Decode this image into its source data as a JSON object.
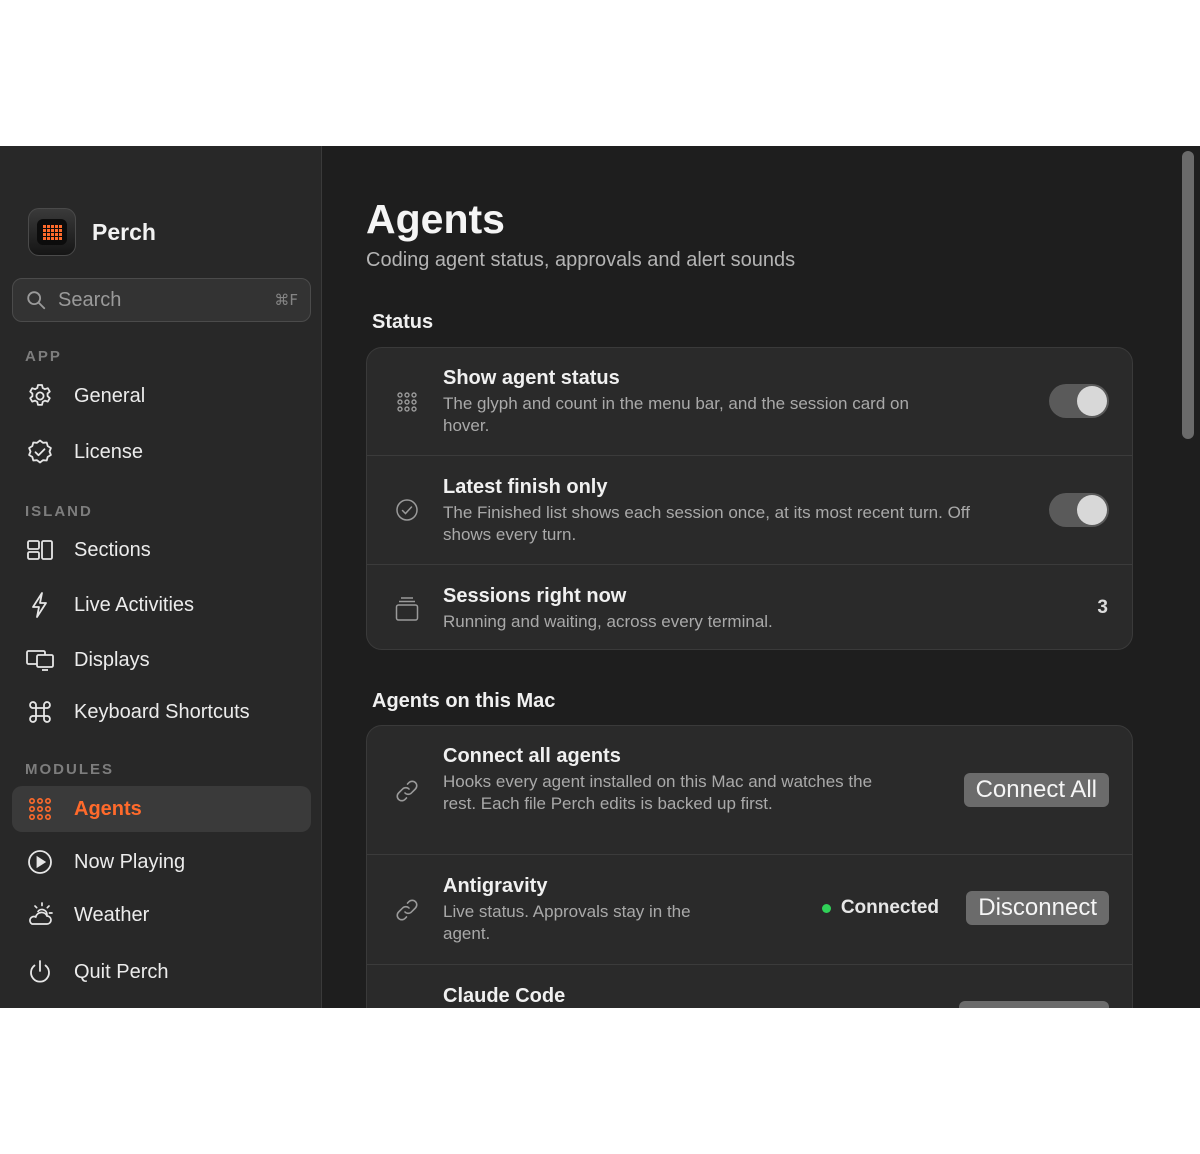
{
  "app": {
    "name": "Perch"
  },
  "search": {
    "placeholder": "Search",
    "shortcut": "⌘F"
  },
  "sidebar": {
    "sections": [
      {
        "label": "APP",
        "items": [
          {
            "label": "General",
            "icon": "gear-icon"
          },
          {
            "label": "License",
            "icon": "verified-badge-icon"
          }
        ]
      },
      {
        "label": "ISLAND",
        "items": [
          {
            "label": "Sections",
            "icon": "sections-layout-icon"
          },
          {
            "label": "Live Activities",
            "icon": "bolt-icon"
          },
          {
            "label": "Displays",
            "icon": "displays-icon"
          },
          {
            "label": "Keyboard Shortcuts",
            "icon": "command-icon"
          }
        ]
      },
      {
        "label": "MODULES",
        "items": [
          {
            "label": "Agents",
            "icon": "dot-grid-icon",
            "active": true
          },
          {
            "label": "Now Playing",
            "icon": "play-circle-icon"
          },
          {
            "label": "Weather",
            "icon": "weather-icon"
          }
        ]
      }
    ],
    "quit_label": "Quit Perch"
  },
  "page": {
    "title": "Agents",
    "subtitle": "Coding agent status, approvals and alert sounds"
  },
  "status_group": {
    "title": "Status",
    "rows": [
      {
        "title": "Show agent status",
        "desc": "The glyph and count in the menu bar, and the session card on hover.",
        "toggle": true
      },
      {
        "title": "Latest finish only",
        "desc": "The Finished list shows each session once, at its most recent turn. Off shows every turn.",
        "toggle": true
      },
      {
        "title": "Sessions right now",
        "desc": "Running and waiting, across every terminal.",
        "value": "3"
      }
    ]
  },
  "agents_group": {
    "title": "Agents on this Mac",
    "connect_all": {
      "title": "Connect all agents",
      "desc": "Hooks every agent installed on this Mac and watches the rest. Each file Perch edits is backed up first.",
      "button": "Connect All"
    },
    "agents": [
      {
        "title": "Antigravity",
        "desc": "Live status. Approvals stay in the agent.",
        "status": "Connected",
        "button": "Disconnect"
      },
      {
        "title": "Claude Code"
      }
    ]
  },
  "colors": {
    "accent": "#ff6a2b",
    "connected": "#30d158",
    "background": "#1e1e1e",
    "sidebar": "#282828"
  }
}
